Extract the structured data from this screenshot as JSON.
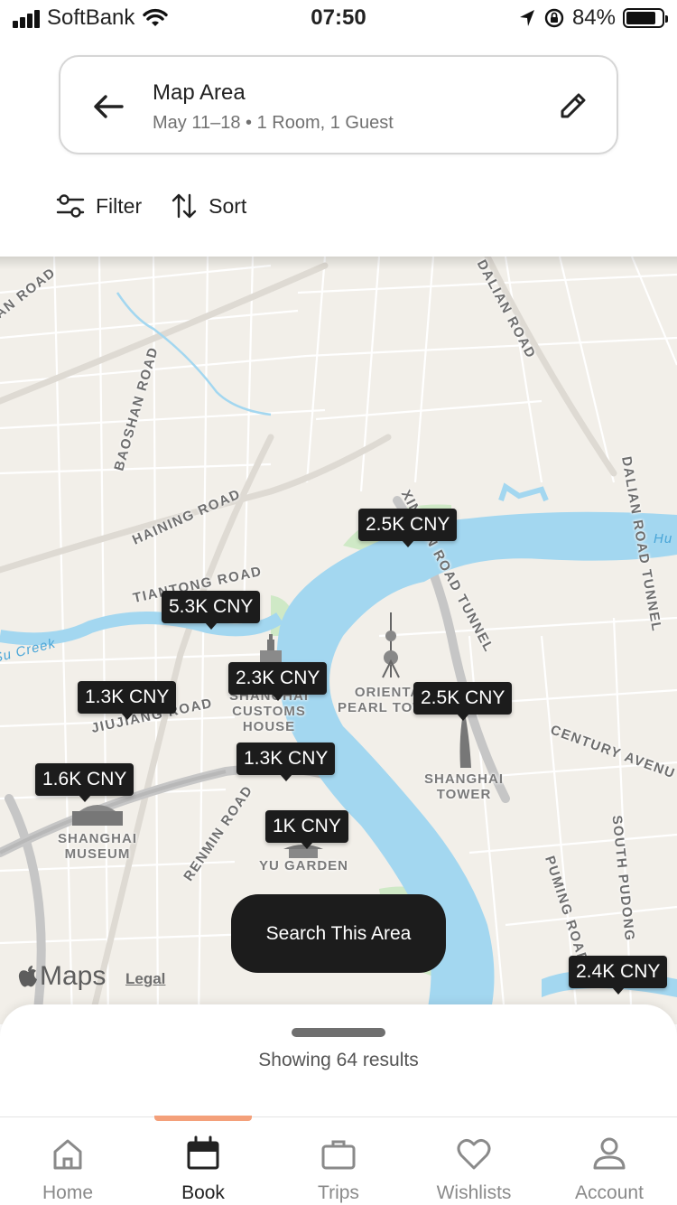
{
  "status_bar": {
    "carrier": "SoftBank",
    "time": "07:50",
    "battery": "84%",
    "battery_level": 0.84,
    "icons": [
      "signal-icon",
      "wifi-icon",
      "location-arrow-icon",
      "rotation-lock-icon",
      "battery-icon"
    ]
  },
  "search": {
    "title": "Map Area",
    "subtitle": "May 11–18 • 1 Room, 1 Guest",
    "back_icon": "arrow-left-icon",
    "edit_icon": "pencil-icon"
  },
  "toolbar": {
    "filter_label": "Filter",
    "sort_label": "Sort"
  },
  "map": {
    "road_labels": {
      "r1": "AN ROAD",
      "r2": "BAOSHAN ROAD",
      "r3": "HAINING ROAD",
      "r4": "TIANTONG ROAD",
      "r5": "JIUJIANG ROAD",
      "r6": "RENMIN ROAD",
      "r7": "DALIAN ROAD",
      "r8": "DALIAN ROAD TUNNEL",
      "r9": "XINJIAN ROAD TUNNEL",
      "r10": "CENTURY AVENU",
      "r11": "PUMING ROAD",
      "r12": "SOUTH PUDONG"
    },
    "poi_labels": {
      "customs": "SHANGHAI\nCUSTOMS\nHOUSE",
      "pearl": "ORIENTAL\nPEARL TOWER",
      "tower": "SHANGHAI\nTOWER",
      "museum": "SHANGHAI\nMUSEUM",
      "garden": "YU GARDEN"
    },
    "water_labels": {
      "creek": "Su Creek",
      "river": "Hu"
    },
    "price_pins": {
      "p1": "2.5K CNY",
      "p2": "5.3K CNY",
      "p3": "2.3K CNY",
      "p4": "1.3K CNY",
      "p5": "2.5K CNY",
      "p6": "1.3K CNY",
      "p7": "1.6K CNY",
      "p8": "1K CNY",
      "p9": "2.4K CNY"
    },
    "search_area_label": "Search This Area",
    "maps_brand": "Maps",
    "legal_label": "Legal"
  },
  "results": {
    "text": "Showing 64 results"
  },
  "tabs": [
    {
      "label": "Home",
      "icon": "home-icon"
    },
    {
      "label": "Book",
      "icon": "calendar-icon"
    },
    {
      "label": "Trips",
      "icon": "briefcase-icon"
    },
    {
      "label": "Wishlists",
      "icon": "heart-icon"
    },
    {
      "label": "Account",
      "icon": "person-icon"
    }
  ],
  "active_tab": "Book",
  "colors": {
    "accent": "#f4a07a",
    "pin_bg": "#1c1c1c",
    "water": "#a3d7f0",
    "map_land": "#f2efe9",
    "park": "#cfe9c6"
  }
}
